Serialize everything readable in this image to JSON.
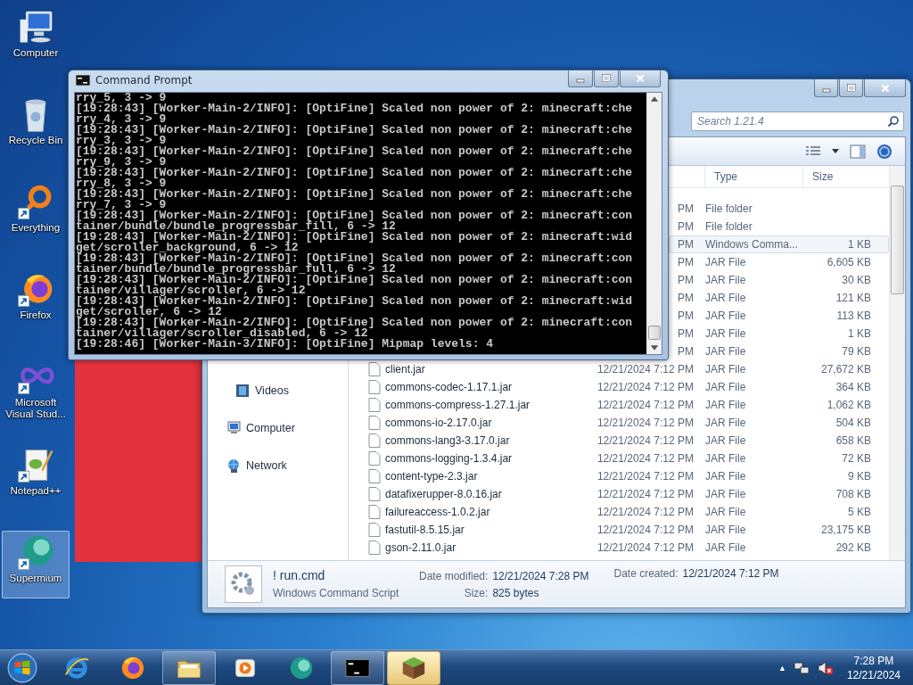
{
  "desktop_icons": [
    {
      "label": "Computer",
      "kind": "computer",
      "selected": false
    },
    {
      "label": "Recycle Bin",
      "kind": "recycle",
      "selected": false
    },
    {
      "label": "Everything",
      "kind": "everything",
      "selected": false
    },
    {
      "label": "Firefox",
      "kind": "firefox",
      "selected": false
    },
    {
      "label": "Microsoft Visual Stud...",
      "kind": "vs",
      "selected": false
    },
    {
      "label": "Notepad++",
      "kind": "notepad",
      "selected": false
    },
    {
      "label": "Supermium",
      "kind": "supermium",
      "selected": true
    }
  ],
  "command_prompt": {
    "title": "Command Prompt",
    "lines": [
      "rry_5, 3 -> 9",
      "[19:28:43] [Worker-Main-2/INFO]: [OptiFine] Scaled non power of 2: minecraft:che",
      "rry_4, 3 -> 9",
      "[19:28:43] [Worker-Main-2/INFO]: [OptiFine] Scaled non power of 2: minecraft:che",
      "rry_3, 3 -> 9",
      "[19:28:43] [Worker-Main-2/INFO]: [OptiFine] Scaled non power of 2: minecraft:che",
      "rry_9, 3 -> 9",
      "[19:28:43] [Worker-Main-2/INFO]: [OptiFine] Scaled non power of 2: minecraft:che",
      "rry_8, 3 -> 9",
      "[19:28:43] [Worker-Main-2/INFO]: [OptiFine] Scaled non power of 2: minecraft:che",
      "rry_7, 3 -> 9",
      "[19:28:43] [Worker-Main-2/INFO]: [OptiFine] Scaled non power of 2: minecraft:con",
      "tainer/bundle/bundle_progressbar_fill, 6 -> 12",
      "[19:28:43] [Worker-Main-2/INFO]: [OptiFine] Scaled non power of 2: minecraft:wid",
      "get/scroller_background, 6 -> 12",
      "[19:28:43] [Worker-Main-2/INFO]: [OptiFine] Scaled non power of 2: minecraft:con",
      "tainer/bundle/bundle_progressbar_full, 6 -> 12",
      "[19:28:43] [Worker-Main-2/INFO]: [OptiFine] Scaled non power of 2: minecraft:con",
      "tainer/villager/scroller, 6 -> 12",
      "[19:28:43] [Worker-Main-2/INFO]: [OptiFine] Scaled non power of 2: minecraft:wid",
      "get/scroller, 6 -> 12",
      "[19:28:43] [Worker-Main-2/INFO]: [OptiFine] Scaled non power of 2: minecraft:con",
      "tainer/villager/scroller_disabled, 6 -> 12",
      "[19:28:46] [Worker-Main-3/INFO]: [OptiFine] Mipmap levels: 4"
    ]
  },
  "explorer": {
    "search": {
      "placeholder": "Search 1.21.4"
    },
    "nav_items": [
      {
        "label": "Videos",
        "kind": "videos"
      },
      {
        "label": "Computer",
        "kind": "computer"
      },
      {
        "label": "Network",
        "kind": "network"
      }
    ],
    "columns": [
      "Type",
      "Size"
    ],
    "rows": [
      {
        "date": "PM",
        "type": "File folder",
        "selected": false
      },
      {
        "date": "PM",
        "type": "File folder",
        "selected": false
      },
      {
        "date": "PM",
        "type": "Windows Comma...",
        "size": "1 KB",
        "selected": true
      },
      {
        "date": "PM",
        "type": "JAR File",
        "size": "6,605 KB",
        "selected": false
      },
      {
        "date": "PM",
        "type": "JAR File",
        "size": "30 KB",
        "selected": false
      },
      {
        "date": "PM",
        "type": "JAR File",
        "size": "121 KB",
        "selected": false
      },
      {
        "date": "PM",
        "type": "JAR File",
        "size": "113 KB",
        "selected": false
      },
      {
        "date": "PM",
        "type": "JAR File",
        "size": "1 KB",
        "selected": false
      },
      {
        "date": "PM",
        "type": "JAR File",
        "size": "79 KB",
        "selected": false
      },
      {
        "name": "client.jar",
        "date": "12/21/2024 7:12 PM",
        "type": "JAR File",
        "size": "27,672 KB",
        "selected": false
      },
      {
        "name": "commons-codec-1.17.1.jar",
        "date": "12/21/2024 7:12 PM",
        "type": "JAR File",
        "size": "364 KB",
        "selected": false
      },
      {
        "name": "commons-compress-1.27.1.jar",
        "date": "12/21/2024 7:12 PM",
        "type": "JAR File",
        "size": "1,062 KB",
        "selected": false
      },
      {
        "name": "commons-io-2.17.0.jar",
        "date": "12/21/2024 7:12 PM",
        "type": "JAR File",
        "size": "504 KB",
        "selected": false
      },
      {
        "name": "commons-lang3-3.17.0.jar",
        "date": "12/21/2024 7:12 PM",
        "type": "JAR File",
        "size": "658 KB",
        "selected": false
      },
      {
        "name": "commons-logging-1.3.4.jar",
        "date": "12/21/2024 7:12 PM",
        "type": "JAR File",
        "size": "72 KB",
        "selected": false
      },
      {
        "name": "content-type-2.3.jar",
        "date": "12/21/2024 7:12 PM",
        "type": "JAR File",
        "size": "9 KB",
        "selected": false
      },
      {
        "name": "datafixerupper-8.0.16.jar",
        "date": "12/21/2024 7:12 PM",
        "type": "JAR File",
        "size": "708 KB",
        "selected": false
      },
      {
        "name": "failureaccess-1.0.2.jar",
        "date": "12/21/2024 7:12 PM",
        "type": "JAR File",
        "size": "5 KB",
        "selected": false
      },
      {
        "name": "fastutil-8.5.15.jar",
        "date": "12/21/2024 7:12 PM",
        "type": "JAR File",
        "size": "23,175 KB",
        "selected": false
      },
      {
        "name": "gson-2.11.0.jar",
        "date": "12/21/2024 7:12 PM",
        "type": "JAR File",
        "size": "292 KB",
        "selected": false
      }
    ],
    "details": {
      "name": "! run.cmd",
      "type": "Windows Command Script",
      "date_modified_label": "Date modified:",
      "date_modified": "12/21/2024 7:28 PM",
      "size_label": "Size:",
      "size": "825 bytes",
      "date_created_label": "Date created:",
      "date_created": "12/21/2024 7:12 PM"
    }
  },
  "taskbar": {
    "items": [
      {
        "kind": "ie",
        "running": false,
        "selected": false
      },
      {
        "kind": "firefox",
        "running": false,
        "selected": false
      },
      {
        "kind": "explorer",
        "running": true,
        "selected": false
      },
      {
        "kind": "media",
        "running": false,
        "selected": false
      },
      {
        "kind": "supermium",
        "running": false,
        "selected": false
      },
      {
        "kind": "cmd",
        "running": true,
        "selected": false
      },
      {
        "kind": "minecraft",
        "running": true,
        "selected": true
      }
    ],
    "tray_toggle": "▲",
    "clock": {
      "time": "7:28 PM",
      "date": "12/21/2024"
    }
  }
}
